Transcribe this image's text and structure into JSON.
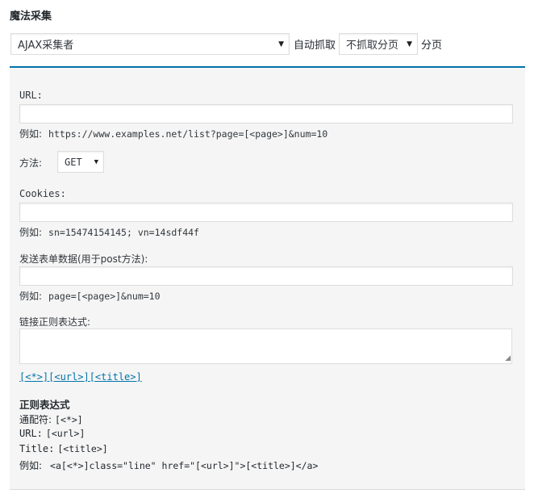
{
  "header": {
    "title": "魔法采集"
  },
  "controls": {
    "collector_select": "AJAX采集者",
    "auto_fetch_label": "自动抓取",
    "page_select": "不抓取分页",
    "page_label": "分页"
  },
  "form": {
    "url": {
      "label": "URL:",
      "value": "",
      "example_label": "例如:",
      "example_value": "https://www.examples.net/list?page=[<page>]&num=10"
    },
    "method": {
      "label": "方法:",
      "value": "GET"
    },
    "cookies": {
      "label": "Cookies:",
      "value": "",
      "example_label": "例如:",
      "example_value": "sn=15474154145; vn=14sdf44f"
    },
    "post_data": {
      "label": "发送表单数据(用于post方法):",
      "value": "",
      "example_label": "例如:",
      "example_value": "page=[<page>]&num=10"
    },
    "link_regex": {
      "label": "链接正则表达式:",
      "value": ""
    },
    "tags": [
      "[<*>]",
      "[<url>]",
      "[<title>]"
    ]
  },
  "help": {
    "title": "正则表达式",
    "lines": [
      {
        "label": "通配符:",
        "value": "[<*>]"
      },
      {
        "label": "URL:",
        "value": "[<url>]"
      },
      {
        "label": "Title:",
        "value": "[<title>]"
      },
      {
        "label": "例如:",
        "value": "<a[<*>]class=\"line\" href=\"[<url>]\">[<title>]</a>"
      }
    ]
  },
  "icons": {
    "dropdown": "chevron-down-icon",
    "resize": "resize-handle-icon"
  },
  "colors": {
    "accent": "#0073aa",
    "panel_bg": "#f5f5f5",
    "link": "#0073aa"
  }
}
